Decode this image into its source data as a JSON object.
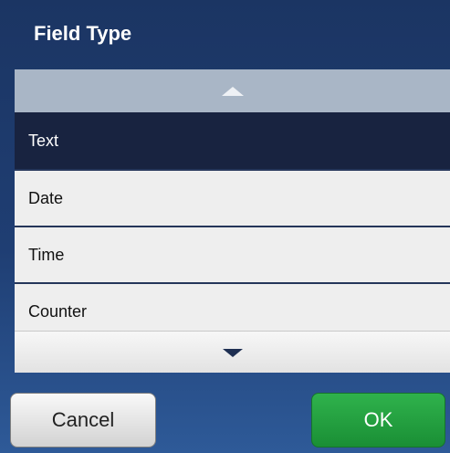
{
  "dialog": {
    "title": "Field Type",
    "scroll_up_icon": "triangle-up-icon",
    "scroll_down_icon": "triangle-down-icon",
    "items": [
      {
        "label": "Text",
        "selected": true
      },
      {
        "label": "Date",
        "selected": false
      },
      {
        "label": "Time",
        "selected": false
      },
      {
        "label": "Counter",
        "selected": false
      }
    ],
    "buttons": {
      "cancel_label": "Cancel",
      "ok_label": "OK"
    }
  },
  "colors": {
    "header_bg": "#1b3563",
    "selected_item_bg": "#182340",
    "ok_button": "#1f9a3c",
    "scroll_up_bg": "#a9b6c6"
  }
}
